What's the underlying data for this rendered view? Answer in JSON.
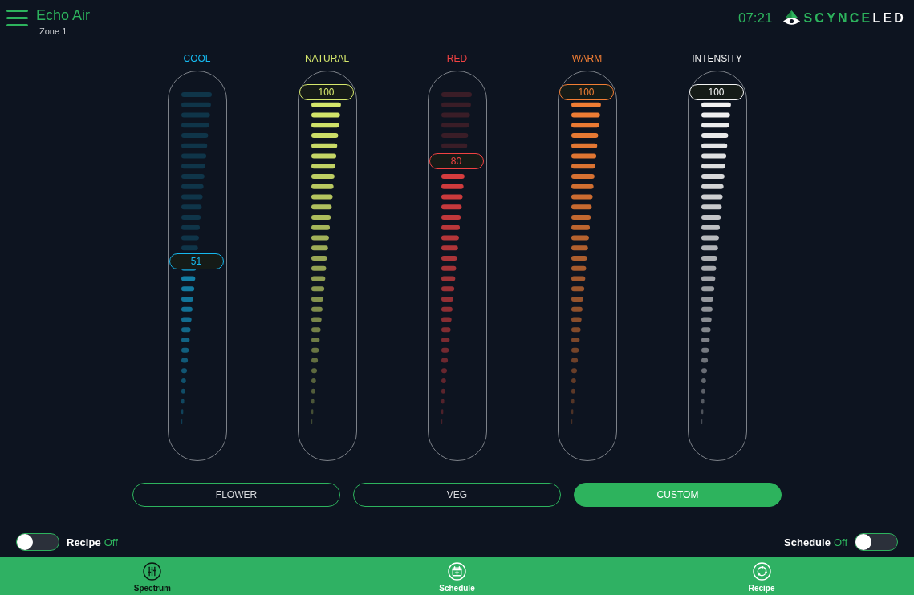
{
  "header": {
    "title": "Echo Air",
    "subtitle": "Zone 1",
    "time": "07:21",
    "logo": {
      "primary": "SCYNCE",
      "secondary": "LED"
    }
  },
  "sliders": [
    {
      "label": "COOL",
      "color": "#16b8ee",
      "level": 0.51,
      "reading": "51"
    },
    {
      "label": "NATURAL",
      "color": "#d6e86c",
      "level": 1,
      "reading": "100"
    },
    {
      "label": "RED",
      "color": "#f04242",
      "level": 0.8,
      "reading": "80"
    },
    {
      "label": "WARM",
      "color": "#f27e34",
      "level": 1,
      "reading": "100"
    },
    {
      "label": "INTENSITY",
      "color": "#f4f4f4",
      "level": 1,
      "reading": "100"
    }
  ],
  "presets": [
    {
      "label": "FLOWER",
      "selected": false
    },
    {
      "label": "VEG",
      "selected": false
    },
    {
      "label": "CUSTOM",
      "selected": true
    }
  ],
  "toggles": [
    {
      "label": "Recipe",
      "status": "Off",
      "on": false
    },
    {
      "label": "Schedule",
      "status": "Off",
      "on": false
    }
  ],
  "nav": [
    {
      "label": "Spectrum",
      "kind": "sliders",
      "selected": true
    },
    {
      "label": "Schedule",
      "kind": "calendar",
      "selected": false
    },
    {
      "label": "Recipe",
      "kind": "cycle",
      "selected": false
    }
  ]
}
